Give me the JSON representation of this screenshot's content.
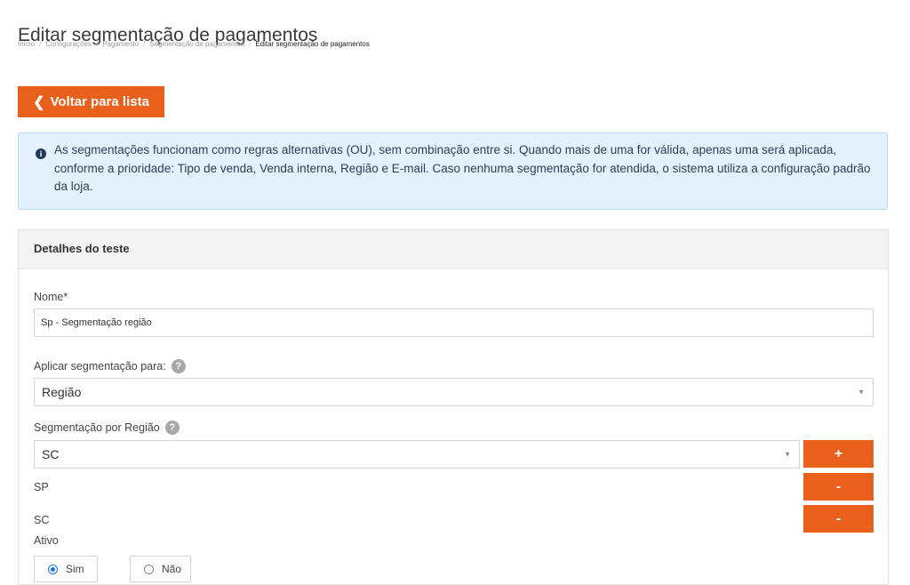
{
  "page": {
    "title": "Editar segmentação de pagamentos"
  },
  "breadcrumb": {
    "items": [
      "Início",
      "Configurações",
      "Pagamento",
      "Segmentação de pagamentos"
    ],
    "current": "Editar segmentação de pagamentos",
    "separator": "/"
  },
  "back_button": {
    "icon": "chevron-left-icon",
    "label": "Voltar para lista"
  },
  "info": {
    "icon": "info-icon",
    "text": "As segmentações funcionam como regras alternativas (OU), sem combinação entre si. Quando mais de uma for válida, apenas uma será aplicada, conforme a prioridade: Tipo de venda, Venda interna, Região e E-mail. Caso nenhuma segmentação for atendida, o sistema utiliza a configuração padrão da loja."
  },
  "panel": {
    "title": "Detalhes do teste",
    "name_label": "Nome*",
    "name_value": "Sp - Segmentação região",
    "apply_label": "Aplicar segmentação para:",
    "apply_value": "Região",
    "region_label": "Segmentação por Região",
    "region_select_value": "SC",
    "add_button": "+",
    "regions": [
      {
        "name": "SP",
        "remove_label": "-"
      },
      {
        "name": "SC",
        "remove_label": "-"
      }
    ],
    "active_label": "Ativo",
    "active_options": [
      {
        "label": "Sim",
        "checked": true
      },
      {
        "label": "Não",
        "checked": false
      }
    ]
  },
  "colors": {
    "accent": "#e8601c",
    "info_bg": "#e3f1fd",
    "info_border": "#b7d9f4",
    "radio": "#1a73e8"
  }
}
